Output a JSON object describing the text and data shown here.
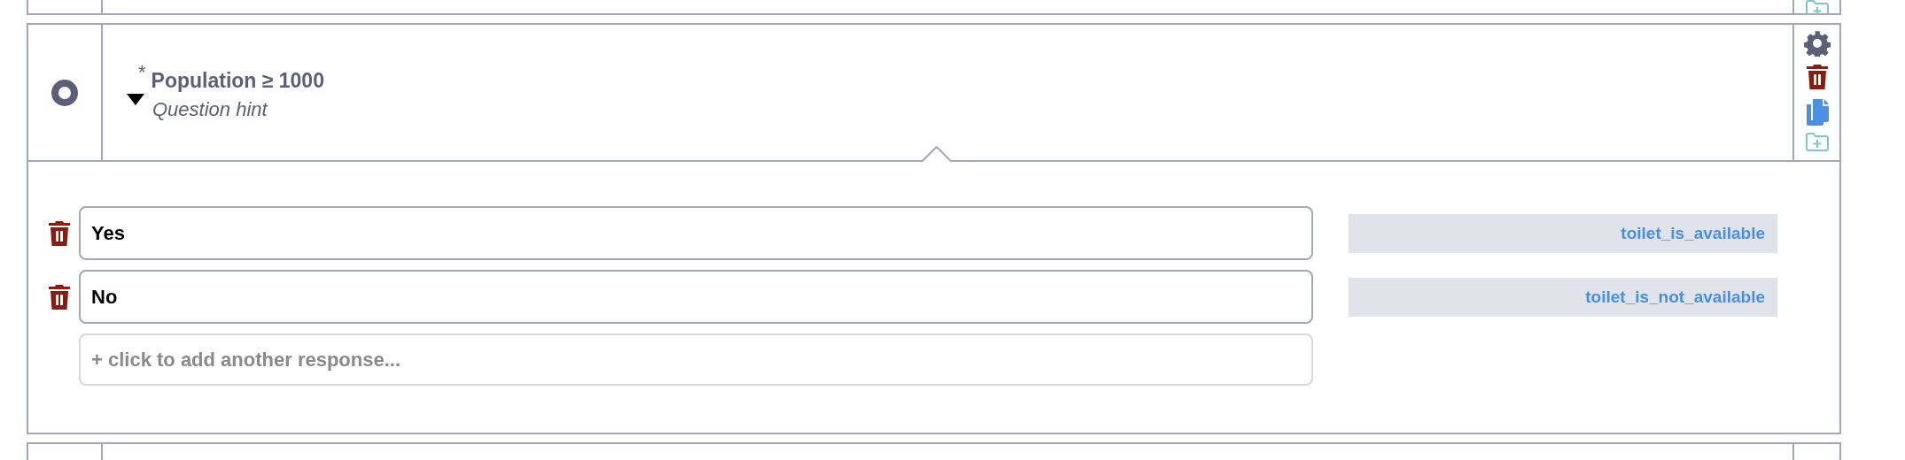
{
  "question": {
    "required_mark": "*",
    "title": "Population ≥ 1000",
    "hint": "Question hint",
    "expanded": true
  },
  "responses": [
    {
      "label": "Yes",
      "value": "toilet_is_available"
    },
    {
      "label": "No",
      "value": "toilet_is_not_available"
    }
  ],
  "add_response": {
    "placeholder": "+ click to add another response..."
  }
}
